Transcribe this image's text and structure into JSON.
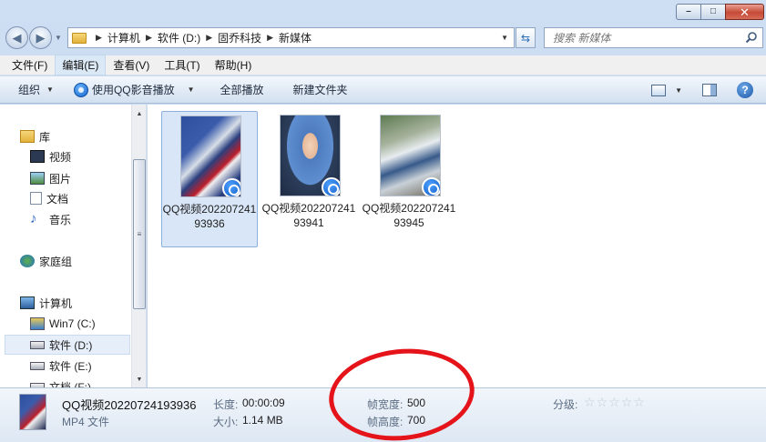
{
  "window": {
    "minimize_glyph": "–",
    "maximize_glyph": "□",
    "close_glyph": "✕"
  },
  "address": {
    "crumbs": [
      "计算机",
      "软件 (D:)",
      "固乔科技",
      "新媒体"
    ],
    "search_placeholder": "搜索 新媒体"
  },
  "menu": [
    "文件(F)",
    "编辑(E)",
    "查看(V)",
    "工具(T)",
    "帮助(H)"
  ],
  "toolbar": {
    "organize": "组织",
    "play_with_qq": "使用QQ影音播放",
    "play_all": "全部播放",
    "new_folder": "新建文件夹",
    "help_glyph": "?"
  },
  "nav": {
    "libraries": "库",
    "videos": "视频",
    "pictures": "图片",
    "documents": "文档",
    "music": "音乐",
    "homegroup": "家庭组",
    "computer": "计算机",
    "drive_c": "Win7 (C:)",
    "drive_d": "软件 (D:)",
    "drive_e": "软件 (E:)",
    "drive_f": "文档 (F:)"
  },
  "files": [
    {
      "name": "QQ视频20220724193936",
      "selected": true
    },
    {
      "name": "QQ视频20220724193941",
      "selected": false
    },
    {
      "name": "QQ视频20220724193945",
      "selected": false
    }
  ],
  "details": {
    "name": "QQ视频20220724193936",
    "type": "MP4 文件",
    "duration_label": "长度:",
    "duration_value": "00:00:09",
    "size_label": "大小:",
    "size_value": "1.14 MB",
    "frame_width_label": "帧宽度:",
    "frame_width_value": "500",
    "frame_height_label": "帧高度:",
    "frame_height_value": "700",
    "rating_label": "分级:",
    "rating_stars": 0
  },
  "colors": {
    "annotation": "#e5141b",
    "selection": "#d8e6f7"
  }
}
